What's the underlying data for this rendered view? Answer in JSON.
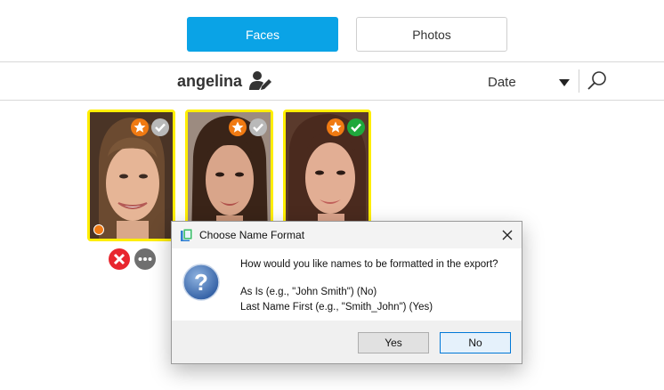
{
  "tabs": {
    "faces_label": "Faces",
    "photos_label": "Photos",
    "active": "Faces"
  },
  "header": {
    "person_name": "angelina",
    "sort_label": "Date"
  },
  "face_cards": [
    {
      "favorite": true,
      "verified": false
    },
    {
      "favorite": true,
      "verified": false
    },
    {
      "favorite": true,
      "verified": true
    }
  ],
  "dialog": {
    "title": "Choose Name Format",
    "question": "How would you like names to be formatted in the export?",
    "option_as_is": "As Is (e.g., \"John Smith\") (No)",
    "option_last_first": "Last Name First (e.g., \"Smith_John\") (Yes)",
    "yes_label": "Yes",
    "no_label": "No"
  },
  "colors": {
    "accent": "#0aa3e6",
    "card_border": "#ffee00",
    "favorite_badge": "#f07a12",
    "verified_badge": "#1fa83c",
    "unverified_badge": "#b9b9b9",
    "delete_action": "#e8262e"
  },
  "icons": {
    "edit_person": "person-edit-icon",
    "search": "search-icon",
    "favorite": "star-icon",
    "verified": "check-icon",
    "delete": "close-icon",
    "more": "more-icon",
    "question": "question-icon"
  }
}
